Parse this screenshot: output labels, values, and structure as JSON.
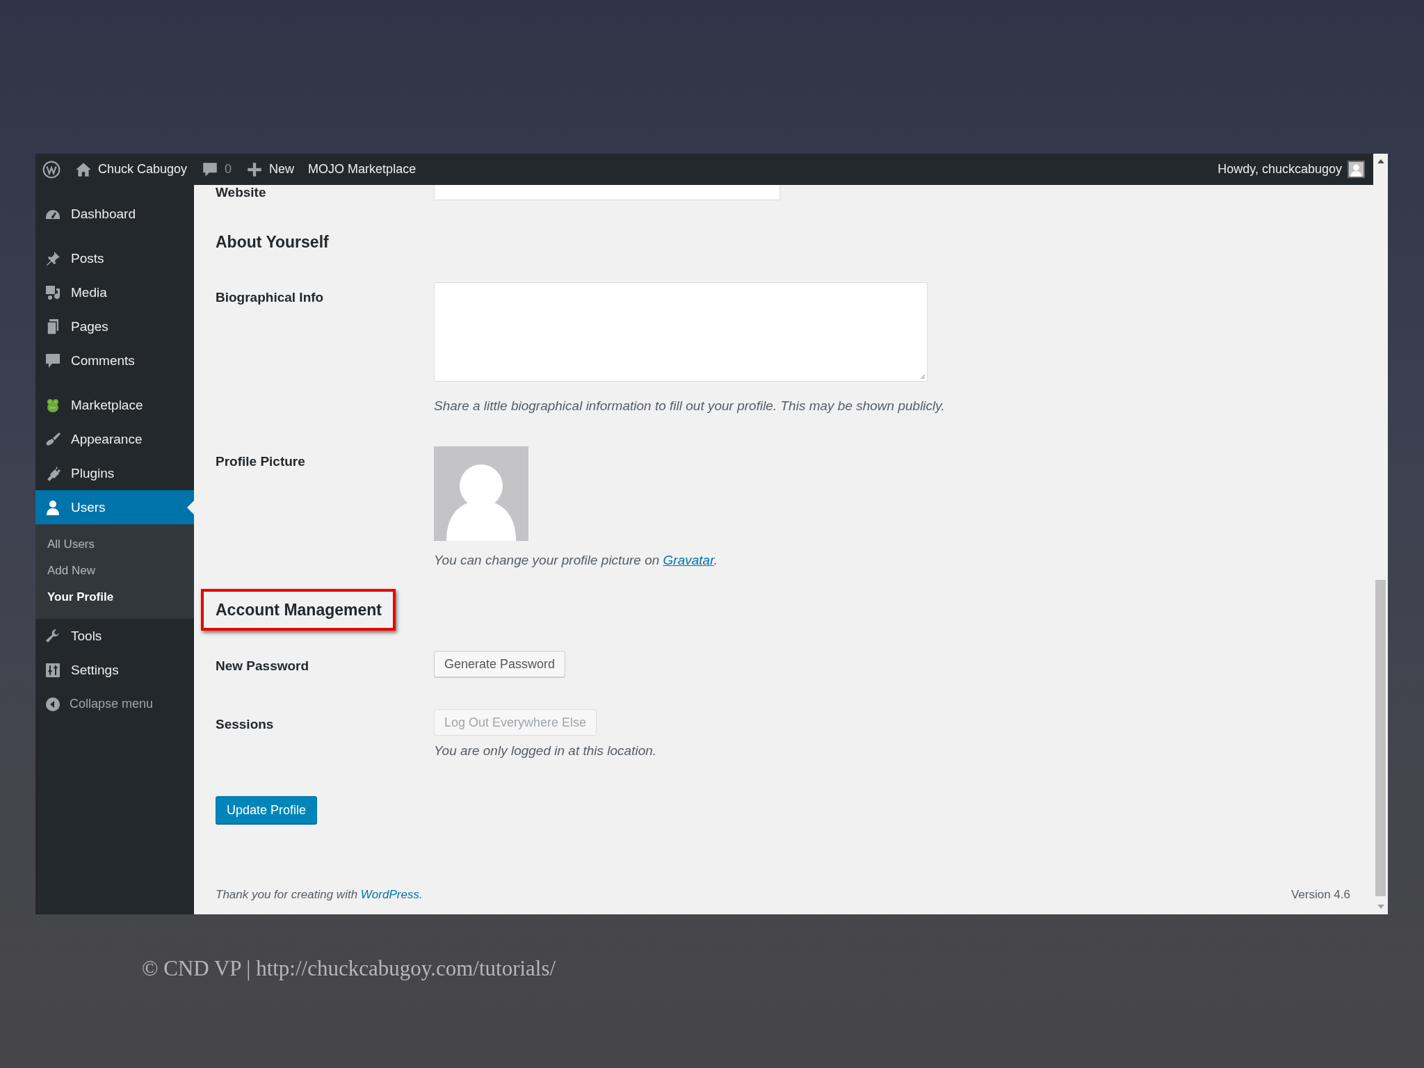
{
  "admin_bar": {
    "site_name": "Chuck Cabugoy",
    "comments_count": "0",
    "new_label": "New",
    "marketplace_label": "MOJO Marketplace",
    "greeting": "Howdy, chuckcabugoy"
  },
  "sidebar": {
    "items": [
      {
        "kind": "menu",
        "label": "Dashboard",
        "selected": false
      },
      {
        "kind": "separator"
      },
      {
        "kind": "menu",
        "label": "Posts",
        "selected": false
      },
      {
        "kind": "menu",
        "label": "Media",
        "selected": false
      },
      {
        "kind": "menu",
        "label": "Pages",
        "selected": false
      },
      {
        "kind": "menu",
        "label": "Comments",
        "selected": false
      },
      {
        "kind": "separator"
      },
      {
        "kind": "menu",
        "label": "Marketplace",
        "selected": false
      },
      {
        "kind": "menu",
        "label": "Appearance",
        "selected": false
      },
      {
        "kind": "menu",
        "label": "Plugins",
        "selected": false
      },
      {
        "kind": "menu",
        "label": "Users",
        "selected": true,
        "children": [
          {
            "label": "All Users",
            "selected": false
          },
          {
            "label": "Add New",
            "selected": false
          },
          {
            "label": "Your Profile",
            "selected": true
          }
        ]
      },
      {
        "kind": "menu",
        "label": "Tools",
        "selected": false
      },
      {
        "kind": "menu",
        "label": "Settings",
        "selected": false
      }
    ],
    "collapse_label": "Collapse menu"
  },
  "form": {
    "rows": [
      {
        "kind": "input",
        "label": "Website"
      },
      {
        "kind": "heading",
        "text": "About Yourself",
        "highlighted": false
      },
      {
        "kind": "textarea",
        "label": "Biographical Info",
        "description": "Share a little biographical information to fill out your profile. This may be shown publicly."
      },
      {
        "kind": "avatar",
        "label": "Profile Picture",
        "description": "You can change your profile picture on ",
        "link": "Gravatar",
        "after": "."
      },
      {
        "kind": "heading",
        "text": "Account Management",
        "highlighted": true
      },
      {
        "kind": "button",
        "label": "New Password",
        "button": "Generate Password",
        "disabled": false
      },
      {
        "kind": "button",
        "label": "Sessions",
        "button": "Log Out Everywhere Else",
        "disabled": true,
        "description": "You are only logged in at this location."
      }
    ],
    "submit": "Update Profile"
  },
  "footer": {
    "text": "Thank you for creating with ",
    "link": "WordPress",
    "after": ".",
    "version": "Version 4.6"
  },
  "slide_caption": "© CND VP | http://chuckcabugoy.com/tutorials/"
}
